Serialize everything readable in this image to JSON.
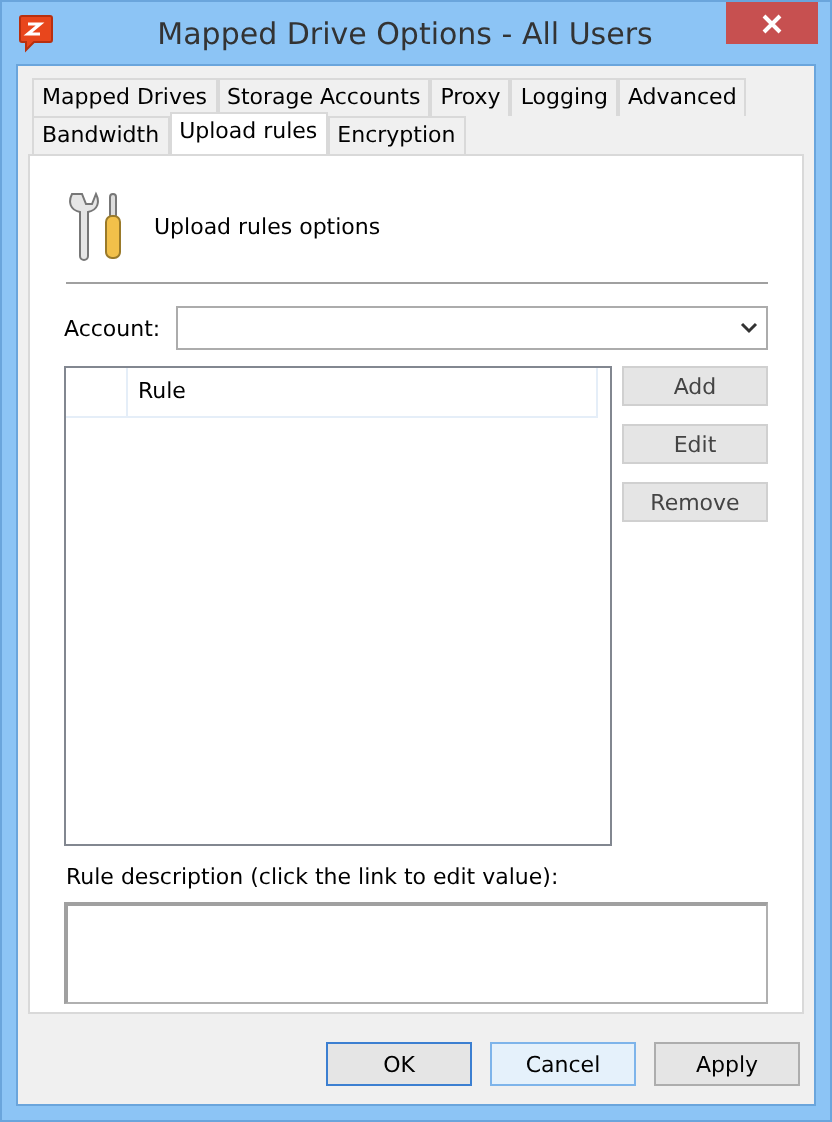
{
  "window": {
    "title": "Mapped Drive Options - All Users"
  },
  "tab_rows": [
    [
      {
        "label": "Mapped Drives",
        "selected": false
      },
      {
        "label": "Storage Accounts",
        "selected": false
      },
      {
        "label": "Proxy",
        "selected": false
      },
      {
        "label": "Logging",
        "selected": false
      },
      {
        "label": "Advanced",
        "selected": false
      }
    ],
    [
      {
        "label": "Bandwidth",
        "selected": false
      },
      {
        "label": "Upload rules",
        "selected": true
      },
      {
        "label": "Encryption",
        "selected": false
      }
    ]
  ],
  "header": {
    "title": "Upload rules options"
  },
  "account": {
    "label": "Account:"
  },
  "rules_table": {
    "columns": [
      "Rule"
    ]
  },
  "side_buttons": [
    "Add",
    "Edit",
    "Remove"
  ],
  "description": {
    "label": "Rule description (click the link to edit value):"
  },
  "buttons": [
    "OK",
    "Cancel",
    "Apply"
  ]
}
